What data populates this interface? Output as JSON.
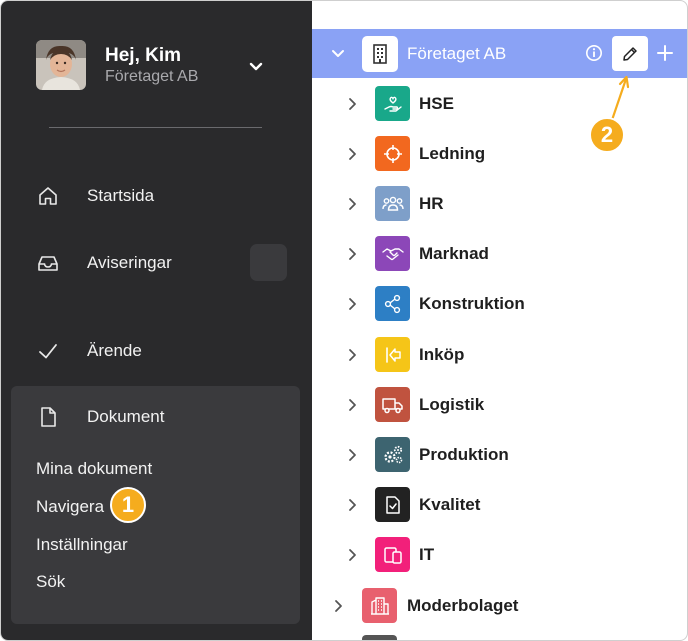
{
  "user": {
    "greeting": "Hej, Kim",
    "company": "Företaget AB"
  },
  "sidebar": {
    "nav": [
      {
        "label": "Startsida",
        "icon": "home-icon"
      },
      {
        "label": "Aviseringar",
        "icon": "inbox-icon"
      },
      {
        "label": "Ärende",
        "icon": "check-icon"
      },
      {
        "label": "Dokument",
        "icon": "document-icon"
      }
    ],
    "document_sub": [
      "Mina dokument",
      "Navigera",
      "Inställningar",
      "Sök"
    ]
  },
  "callouts": [
    "1",
    "2"
  ],
  "tree": {
    "root": {
      "label": "Företaget AB",
      "color": "#8aa2f5"
    },
    "items": [
      {
        "label": "HSE",
        "color": "#19a88a",
        "icon": "heart-hand-icon"
      },
      {
        "label": "Ledning",
        "color": "#f2681f",
        "icon": "target-icon"
      },
      {
        "label": "HR",
        "color": "#7e9fc9",
        "icon": "people-icon"
      },
      {
        "label": "Marknad",
        "color": "#8c47b8",
        "icon": "handshake-icon"
      },
      {
        "label": "Konstruktion",
        "color": "#2d7fc5",
        "icon": "share-icon"
      },
      {
        "label": "Inköp",
        "color": "#f5c518",
        "icon": "arrow-in-icon"
      },
      {
        "label": "Logistik",
        "color": "#c0533f",
        "icon": "truck-icon"
      },
      {
        "label": "Produktion",
        "color": "#3d6470",
        "icon": "gears-icon"
      },
      {
        "label": "Kvalitet",
        "color": "#222222",
        "icon": "doc-check-icon"
      },
      {
        "label": "IT",
        "color": "#f2207a",
        "icon": "devices-icon"
      }
    ],
    "sibling": {
      "label": "Moderbolaget",
      "color": "#e8606e",
      "icon": "building-icon"
    }
  }
}
